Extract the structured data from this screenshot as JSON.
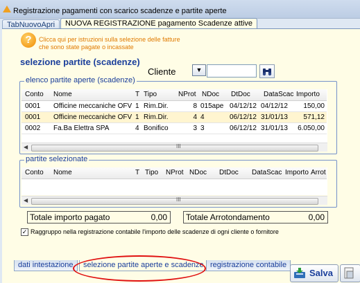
{
  "window": {
    "title": "Registrazione pagamenti con scarico scadenze e partite aperte"
  },
  "tabs": [
    {
      "label": "TabNuovoApri"
    },
    {
      "label": "NUOVA REGISTRAZIONE pagamento Scadenze attive"
    }
  ],
  "info": {
    "text": "Clicca qui per istruzioni sulla selezione delle fatture che sono state pagate o incassate"
  },
  "section_title": "selezione partite (scadenze)",
  "cliente": {
    "label": "Cliente",
    "dropdown": "▼",
    "value": ""
  },
  "open_items": {
    "title": "elenco partite aperte (scadenze)",
    "columns": [
      "Conto",
      "Nome",
      "T",
      "Tipo",
      "NProt",
      "NDoc",
      "DtDoc",
      "DataScac",
      "Importo"
    ],
    "rows": [
      {
        "conto": "0001",
        "nome": "Officine meccaniche OFV",
        "t": "1",
        "tipo": "Rim.Dir.",
        "nprot": "8",
        "ndoc": "015ape",
        "dtdoc": "04/12/12",
        "datascad": "04/12/12",
        "importo": "150,00"
      },
      {
        "conto": "0001",
        "nome": "Officine meccaniche OFV",
        "t": "1",
        "tipo": "Rim.Dir.",
        "nprot": "4",
        "ndoc": "4",
        "dtdoc": "06/12/12",
        "datascad": "31/01/13",
        "importo": "571,12"
      },
      {
        "conto": "0002",
        "nome": "Fa.Ba Elettra SPA",
        "t": "4",
        "tipo": "Bonifico",
        "nprot": "3",
        "ndoc": "3",
        "dtdoc": "06/12/12",
        "datascad": "31/01/13",
        "importo": "6.050,00"
      }
    ],
    "selected_row": 1,
    "scroll_thumb": "III"
  },
  "selected_items": {
    "title": "partite selezionate",
    "columns": [
      "Conto",
      "Nome",
      "T",
      "Tipo",
      "NProt",
      "NDoc",
      "DtDoc",
      "DataScac",
      "Importo",
      "Arrot"
    ],
    "scroll_thumb": "III"
  },
  "totals": {
    "pagato_label": "Totale importo pagato",
    "pagato_value": "0,00",
    "arrot_label": "Totale Arrotondamento",
    "arrot_value": "0,00"
  },
  "grouping": {
    "checked": true,
    "label": "Raggruppo nella registrazione contabile l'importo delle scadenze di ogni cliente o fornitore"
  },
  "bottom_tabs": [
    {
      "label": "dati intestazione"
    },
    {
      "label": "selezione partite aperte e scadenze"
    },
    {
      "label": "registrazione contabile"
    }
  ],
  "actions": {
    "save_label": "Salva"
  },
  "colors": {
    "accent": "#1a3e9b",
    "info": "#e07a00",
    "highlight": "#e01010",
    "page_bg": "#fffde6"
  }
}
